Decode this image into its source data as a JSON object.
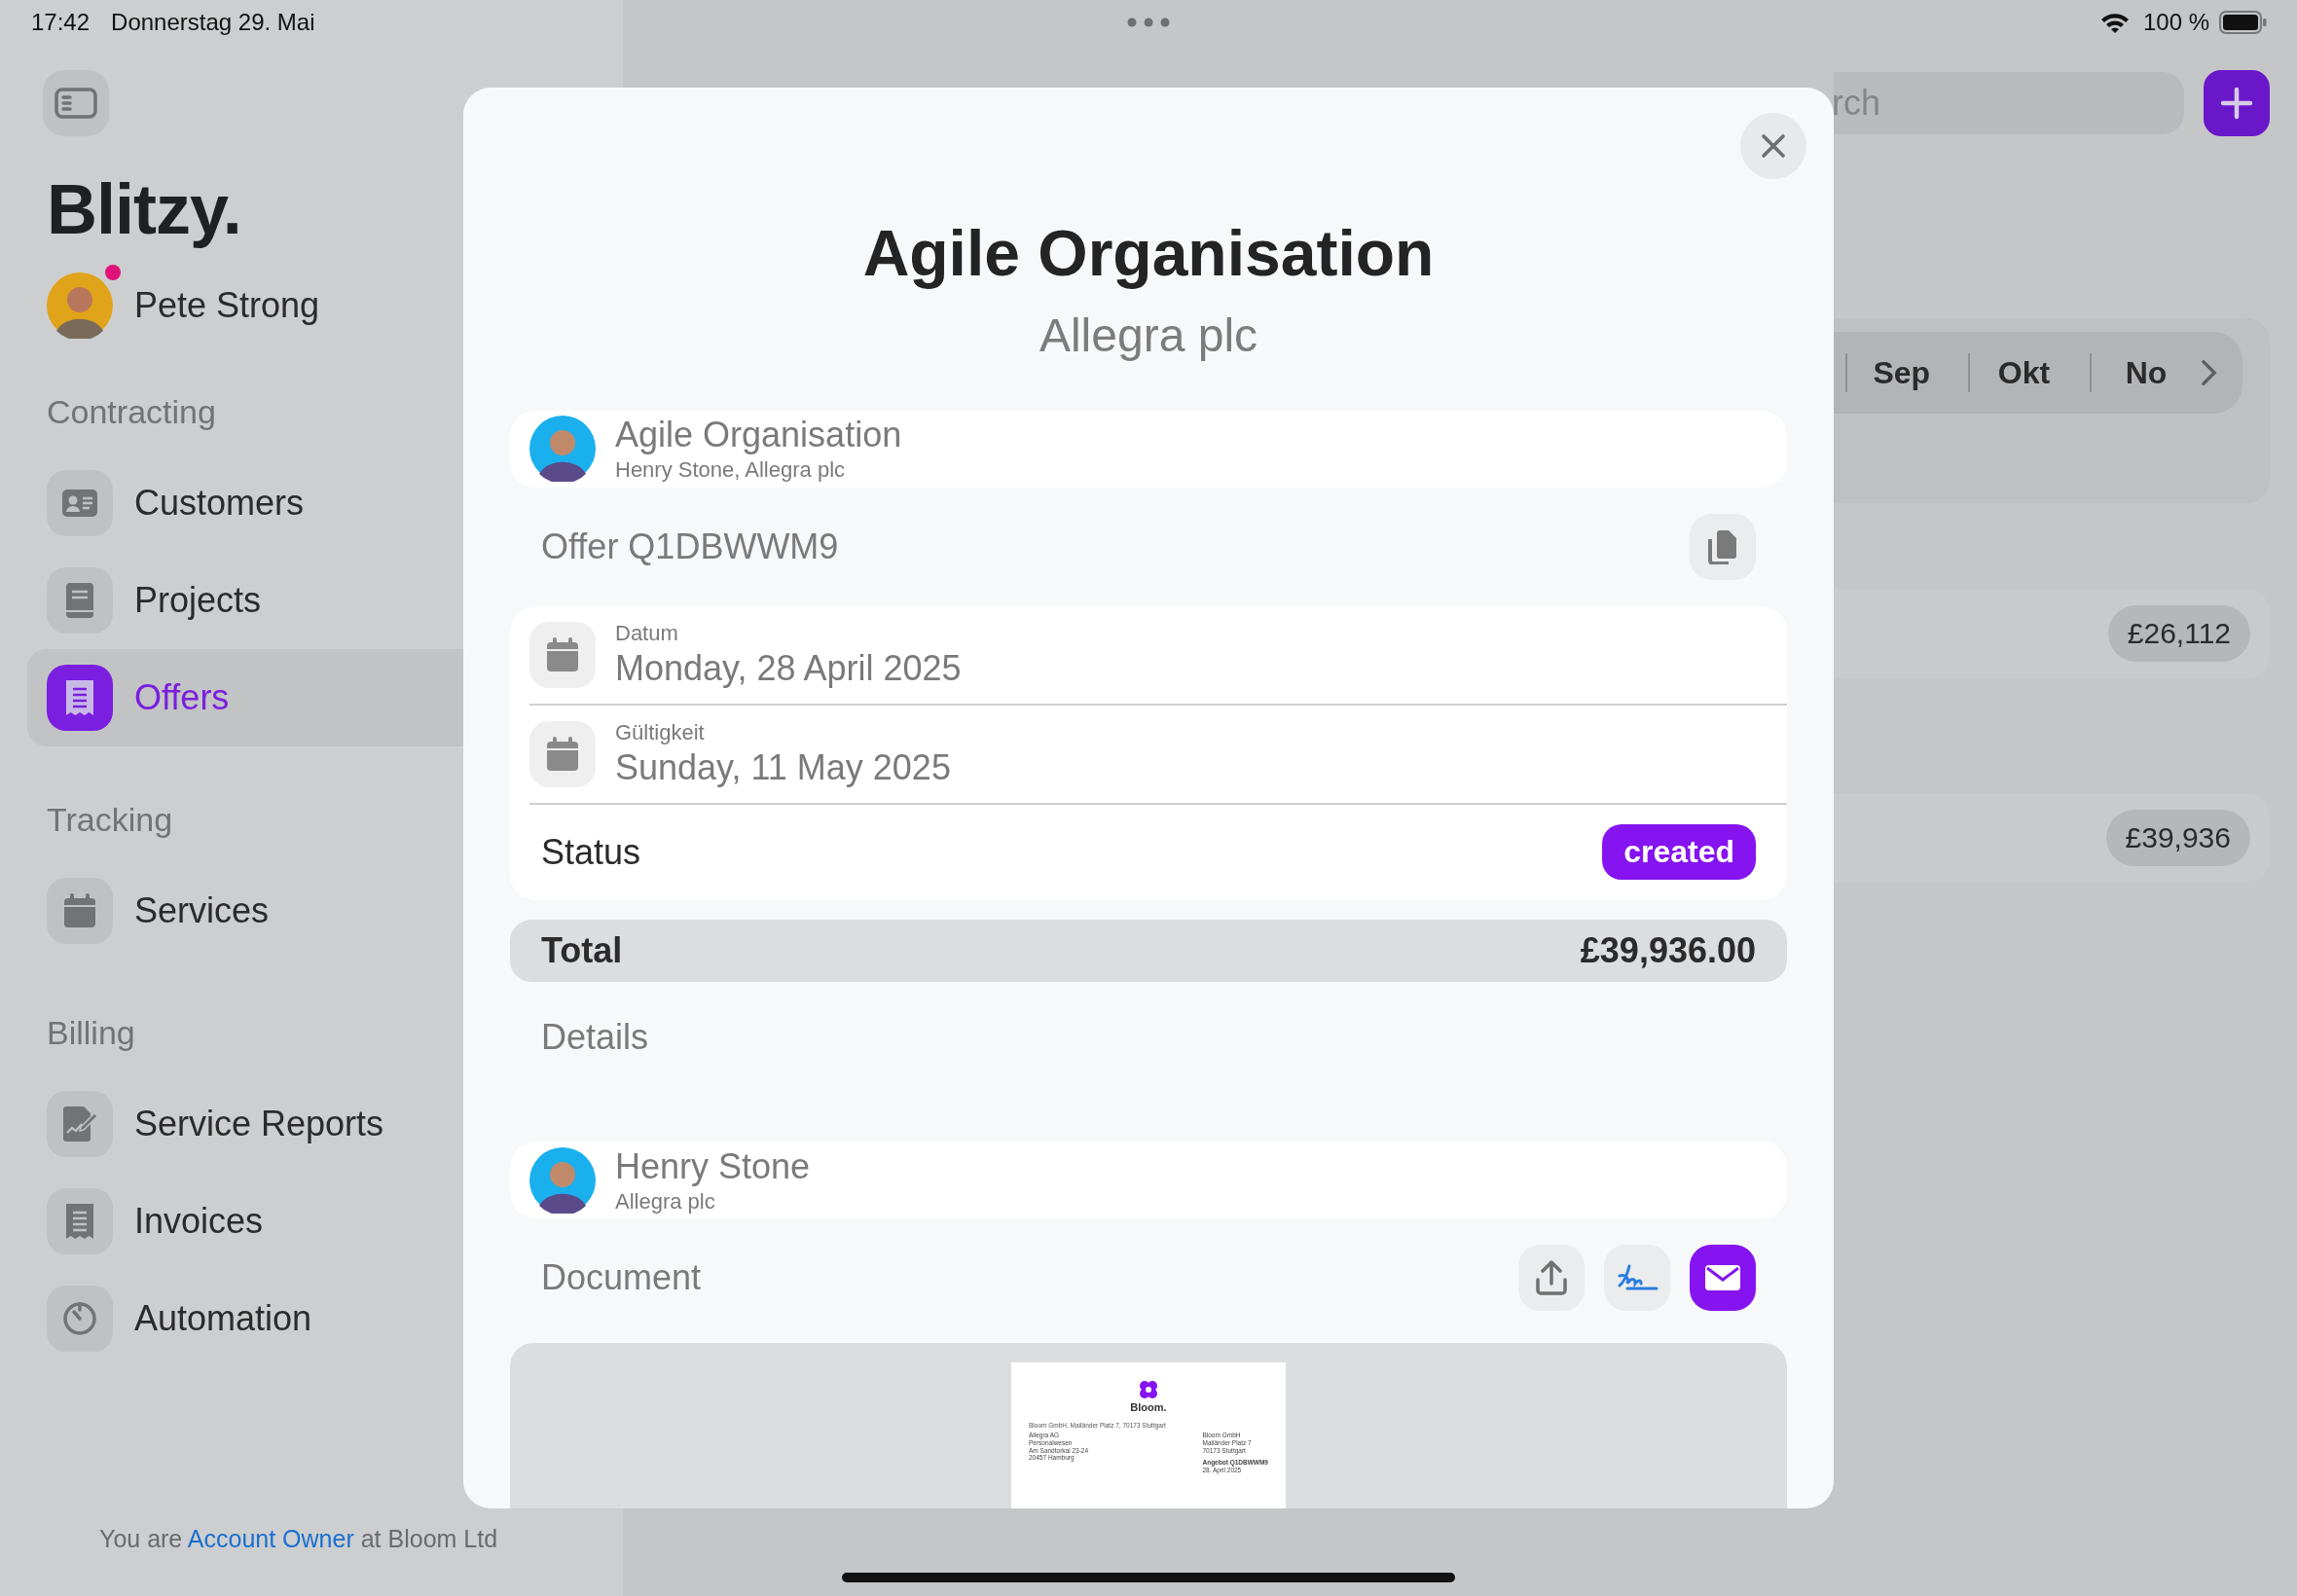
{
  "status_bar": {
    "time": "17:42",
    "date": "Donnerstag 29. Mai",
    "battery": "100 %"
  },
  "sidebar": {
    "app_title": "Blitzy.",
    "user": {
      "name": "Pete Strong",
      "notification": true
    },
    "sections": [
      {
        "title": "Contracting",
        "items": [
          {
            "label": "Customers",
            "selected": false
          },
          {
            "label": "Projects",
            "selected": false
          },
          {
            "label": "Offers",
            "selected": true
          }
        ]
      },
      {
        "title": "Tracking",
        "items": [
          {
            "label": "Services",
            "selected": false
          }
        ]
      },
      {
        "title": "Billing",
        "items": [
          {
            "label": "Service Reports",
            "selected": false
          },
          {
            "label": "Invoices",
            "selected": false
          },
          {
            "label": "Automation",
            "selected": false
          }
        ]
      }
    ],
    "footer": {
      "prefix": "You are",
      "link": "Account Owner",
      "suffix": "at Bloom Ltd"
    }
  },
  "background": {
    "search": {
      "placeholder": "rch"
    },
    "months": [
      "Sep",
      "Okt",
      "No"
    ],
    "amounts": [
      "£26,112",
      "£39,936"
    ]
  },
  "modal": {
    "title": "Agile Organisation",
    "subtitle": "Allegra plc",
    "project_card": {
      "title": "Agile Organisation",
      "subtitle": "Henry Stone, Allegra plc"
    },
    "offer_heading": "Offer Q1DBWWM9",
    "dates": [
      {
        "label": "Datum",
        "value": "Monday, 28 April 2025"
      },
      {
        "label": "Gültigkeit",
        "value": "Sunday, 11 May 2025"
      }
    ],
    "status": {
      "label": "Status",
      "value": "created"
    },
    "total": {
      "label": "Total",
      "value": "£39,936.00"
    },
    "details_heading": "Details",
    "contact": {
      "name": "Henry Stone",
      "company": "Allegra plc"
    },
    "document_heading": "Document",
    "document_preview": {
      "logo_text": "Bloom.",
      "sender_line": "Bloom GmbH, Mailänder Platz 7, 70173 Stuttgart",
      "recipient_lines": [
        "Allegra AG",
        "Personalwesen",
        "Am Sandtorkai 23-24",
        "20457 Hamburg"
      ],
      "company_lines": [
        "Bloom GmbH",
        "Mailänder Platz 7",
        "70173 Stuttgart"
      ],
      "offer_title": "Angebot Q1DBWWM9",
      "offer_date": "28. April 2025"
    }
  }
}
